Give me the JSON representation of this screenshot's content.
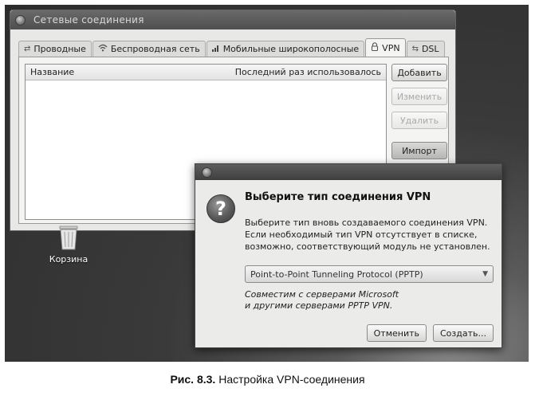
{
  "main_window": {
    "title": "Сетевые соединения",
    "tabs": [
      {
        "label": "Проводные",
        "icon": "wired-icon"
      },
      {
        "label": "Беспроводная сеть",
        "icon": "wireless-icon"
      },
      {
        "label": "Мобильные широкополосные",
        "icon": "signal-bars-icon"
      },
      {
        "label": "VPN",
        "icon": "lock-icon",
        "active": true
      },
      {
        "label": "DSL",
        "icon": "dsl-icon"
      }
    ],
    "list": {
      "columns": [
        "Название",
        "Последний раз использовалось"
      ]
    },
    "buttons": {
      "add": "Добавить",
      "edit": "Изменить",
      "delete": "Удалить",
      "import": "Импорт"
    }
  },
  "desktop": {
    "trash_label": "Корзина"
  },
  "vpn_dialog": {
    "heading": "Выберите тип соединения VPN",
    "description": "Выберите тип вновь создаваемого соединения VPN. Если необходимый тип VPN отсутствует в списке, возможно, соответствующий модуль не установлен.",
    "selected_type": "Point-to-Point Tunneling Protocol (PPTP)",
    "compat_line1": "Совместим с серверами Microsoft",
    "compat_line2": "и другими серверами PPTP VPN.",
    "cancel": "Отменить",
    "create": "Создать..."
  },
  "caption": {
    "number": "Рис. 8.3.",
    "text": "Настройка VPN-соединения"
  }
}
